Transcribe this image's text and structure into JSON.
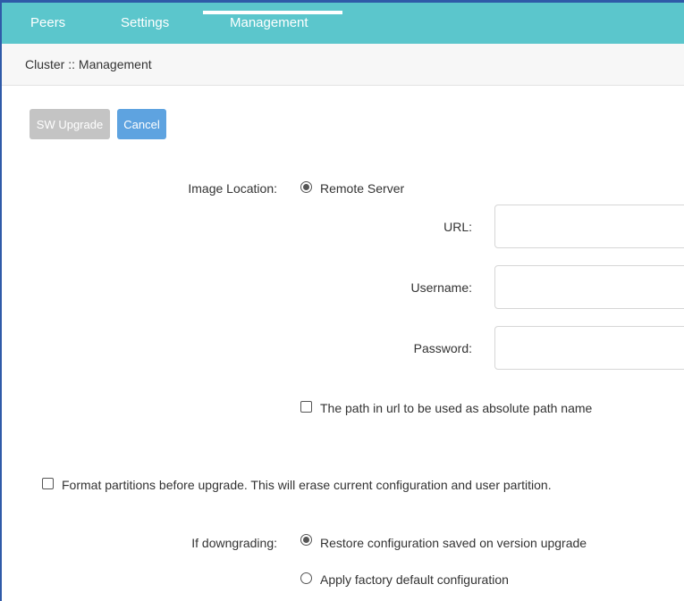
{
  "nav": {
    "tabs": [
      {
        "label": "Peers"
      },
      {
        "label": "Settings"
      },
      {
        "label": "Management"
      }
    ]
  },
  "breadcrumb": "Cluster :: Management",
  "toolbar": {
    "upgrade_label": "SW Upgrade",
    "cancel_label": "Cancel"
  },
  "form": {
    "image_location_label": "Image Location:",
    "image_location_option": "Remote Server",
    "url_label": "URL:",
    "url_value": "",
    "username_label": "Username:",
    "username_value": "",
    "password_label": "Password:",
    "password_value": "",
    "absolute_path_label": "The path in url to be used as absolute path name",
    "format_partitions_label": "Format partitions before upgrade. This will erase current configuration and user partition.",
    "downgrade_label": "If downgrading:",
    "downgrade_options": [
      {
        "label": "Restore configuration saved on version upgrade",
        "selected": true
      },
      {
        "label": "Apply factory default configuration",
        "selected": false
      }
    ]
  },
  "colors": {
    "nav_bg": "#5bc6cc",
    "accent_blue": "#5ea3e0",
    "disabled_button": "#c4c4c4"
  }
}
